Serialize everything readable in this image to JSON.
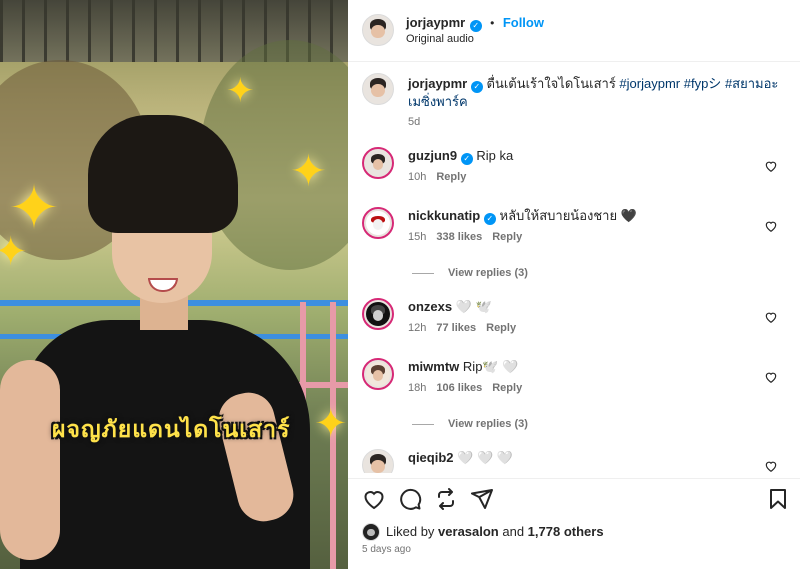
{
  "video": {
    "overlay_caption": "ผจญภัยแดนไดโนเสาร์"
  },
  "header": {
    "username": "jorjaypmr",
    "follow_label": "Follow",
    "audio": "Original audio"
  },
  "caption": {
    "username": "jorjaypmr",
    "text_plain": "ตื่นเต้นเร้าใจไดโนเสาร์ ",
    "hashtag1": "#jorjaypmr",
    "hashtag2": "#fypシ",
    "hashtag3": "#สยามอะเมซิ่งพาร์ค",
    "time": "5d"
  },
  "comments": [
    {
      "username": "guzjun9",
      "verified": true,
      "text": "Rip ka",
      "time": "10h",
      "likes": "",
      "reply": "Reply"
    },
    {
      "username": "nickkunatip",
      "verified": true,
      "text": "หลับให้สบายน้องชาย 🖤",
      "time": "15h",
      "likes": "338 likes",
      "reply": "Reply",
      "view_replies": "View replies (3)"
    },
    {
      "username": "onzexs",
      "verified": false,
      "text": "🤍 🕊️",
      "time": "12h",
      "likes": "77 likes",
      "reply": "Reply"
    },
    {
      "username": "miwmtw",
      "verified": false,
      "text": "Rip🕊️ 🤍",
      "time": "18h",
      "likes": "106 likes",
      "reply": "Reply",
      "view_replies": "View replies (3)"
    },
    {
      "username": "qieqib2",
      "verified": false,
      "text": "🤍 🤍 🤍",
      "time": "",
      "likes": "",
      "reply": ""
    }
  ],
  "likes_line": {
    "prefix": "Liked by ",
    "user": "verasalon",
    "middle": " and ",
    "count": "1,778 others"
  },
  "posted_ago": "5 days ago",
  "colors": {
    "accent": "#0095f6",
    "text": "#262626",
    "muted": "#737373",
    "sparkle": "#ffd21a"
  },
  "icons": [
    "heart-icon",
    "comment-icon",
    "repost-icon",
    "share-icon",
    "save-icon",
    "verified-icon"
  ]
}
